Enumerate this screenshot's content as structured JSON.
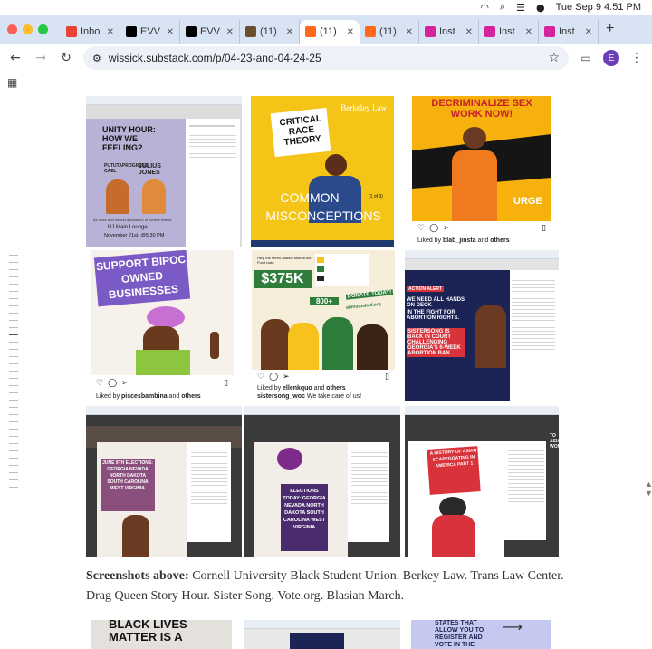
{
  "system": {
    "date_time": "Tue Sep 9  4:51 PM"
  },
  "tabs": [
    {
      "label": "Inbo",
      "icon": "gmail-icon",
      "color": "#ea4335",
      "active": false
    },
    {
      "label": "EVV",
      "icon": "x-icon",
      "color": "#000000",
      "active": false
    },
    {
      "label": "EVV",
      "icon": "x-icon",
      "color": "#000000",
      "active": false
    },
    {
      "label": "(11)",
      "icon": "site-icon",
      "color": "#6b4e2e",
      "active": false
    },
    {
      "label": "(11)",
      "icon": "substack-icon",
      "color": "#ff6719",
      "active": true
    },
    {
      "label": "(11)",
      "icon": "substack-icon",
      "color": "#ff6719",
      "active": false
    },
    {
      "label": "Inst",
      "icon": "instagram-icon",
      "color": "#d6249f",
      "active": false
    },
    {
      "label": "Inst",
      "icon": "instagram-icon",
      "color": "#d6249f",
      "active": false
    },
    {
      "label": "Inst",
      "icon": "instagram-icon",
      "color": "#d6249f",
      "active": false
    }
  ],
  "omnibox": {
    "url": "wissick.substack.com/p/04-23-and-04-24-25"
  },
  "profile": {
    "initial": "E"
  },
  "tiles": {
    "unity": {
      "title": "UNITY HOUR: HOW WE FEELING?",
      "speaker1": "PUTUTAPROGRESS CAEL",
      "speaker2": "JULIUS JONES",
      "tagline": "An open and honest discussion of current events",
      "place": "UJ Main Lounge",
      "when": "November 21st, @5:30 PM"
    },
    "crt": {
      "top": "CRITICAL RACE THEORY",
      "brand": "Berkeley Law",
      "line1": "COMMON",
      "line2": "MISCONCEPTIONS",
      "count": "(1 of 9)"
    },
    "decrim": {
      "head": "DECRIMINALIZE SEX WORK NOW!",
      "brand": "URGE",
      "liked_by": "blab_jinsta",
      "liked_others": "others"
    },
    "bipoc": {
      "sign": "SUPPORT BIPOC OWNED BUSINESSES",
      "liked_by": "piscesbambina",
      "liked_others": "others"
    },
    "mutual": {
      "header": "Help the Metro Atlanta Mutual Aid Fund raise",
      "amount": "$375K",
      "people": "800+",
      "donate": "DONATE TODAY!",
      "site": "atlmutualaid.org",
      "liked_by": "ellenkquo",
      "liked_others": "others",
      "comment_user": "sistersong_woc",
      "comment": "We take care of us!"
    },
    "alert": {
      "tag": "ACTION ALERT",
      "line1": "WE NEED ALL HANDS ON DECK",
      "line2": "IN THE FIGHT FOR ABORTION RIGHTS.",
      "line3": "SISTERSONG IS BACK IN COURT CHALLENGING GEORGIA'S 6-WEEK ABORTION BAN."
    },
    "june": {
      "sign": "JUNE 9TH ELECTIONS: GEORGIA NEVADA NORTH DAKOTA SOUTH CAROLINA WEST VIRGINIA"
    },
    "today": {
      "sign": "ELECTIONS TODAY: GEORGIA NEVADA NORTH DAKOTA SOUTH CAROLINA WEST VIRGINIA"
    },
    "asian": {
      "sign": "A HISTORY OF ASIAN SCAPEGOATING IN AMERICA PART 1",
      "side": "TO ASIAN WOMEN"
    }
  },
  "caption": {
    "lead": "Screenshots above:",
    "text": " Cornell University Black Student Union. Berkey Law. Trans Law Center. Drag Queen Story Hour. Sister Song. Vote.org. Blasian March."
  },
  "bottom_tiles": {
    "blm": "BLACK LIVES MATTER IS A",
    "vote": "STATES THAT ALLOW YOU TO REGISTER AND VOTE IN THE"
  }
}
